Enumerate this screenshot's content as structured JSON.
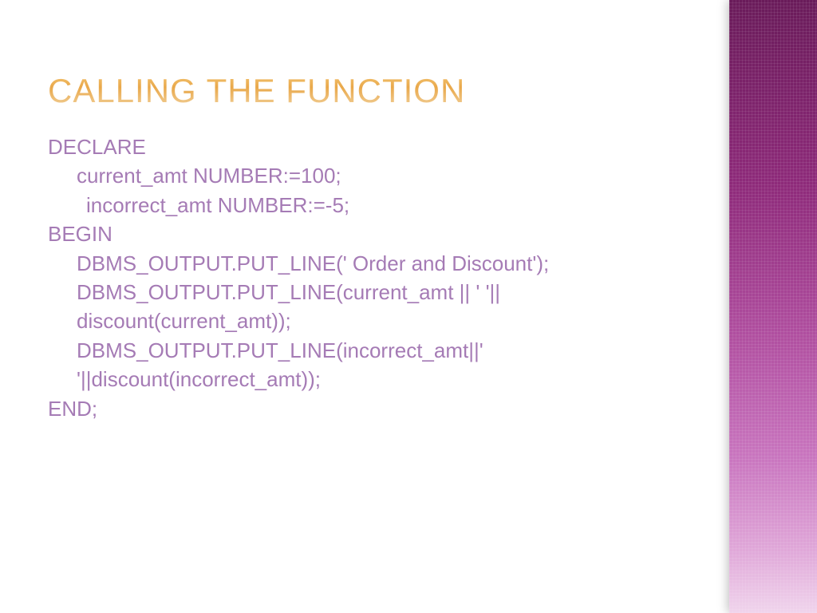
{
  "title": "Calling the function",
  "code": {
    "l1": "DECLARE",
    "l2": "current_amt NUMBER:=100;",
    "l3": "incorrect_amt NUMBER:=-5;",
    "l4": "BEGIN",
    "l5": "DBMS_OUTPUT.PUT_LINE(' Order and Discount');",
    "l6": "DBMS_OUTPUT.PUT_LINE(current_amt || '      '|| discount(current_amt));",
    "l7": "DBMS_OUTPUT.PUT_LINE(incorrect_amt||'    '||discount(incorrect_amt));",
    "l8": "END;"
  }
}
